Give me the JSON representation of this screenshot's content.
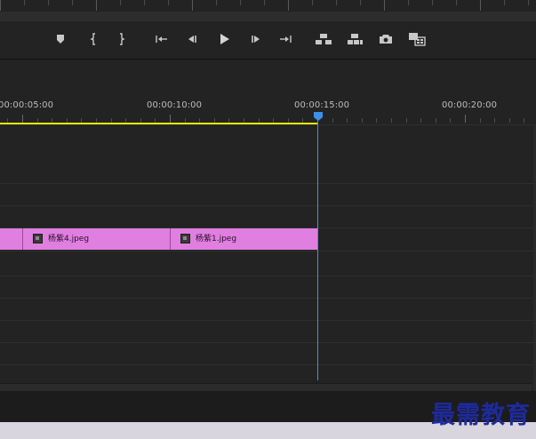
{
  "transport": {
    "controls": [
      {
        "name": "add-marker-button",
        "icon": "marker-icon"
      },
      {
        "name": "mark-in-button",
        "icon": "mark-in-icon"
      },
      {
        "name": "mark-out-button",
        "icon": "mark-out-icon"
      },
      {
        "name": "go-to-in-button",
        "icon": "go-to-in-icon"
      },
      {
        "name": "step-back-button",
        "icon": "step-back-icon"
      },
      {
        "name": "play-button",
        "icon": "play-icon"
      },
      {
        "name": "step-forward-button",
        "icon": "step-forward-icon"
      },
      {
        "name": "go-to-out-button",
        "icon": "go-to-out-icon"
      },
      {
        "name": "lift-button",
        "icon": "lift-icon"
      },
      {
        "name": "extract-button",
        "icon": "extract-icon"
      },
      {
        "name": "export-frame-button",
        "icon": "camera-icon"
      },
      {
        "name": "comparison-view-button",
        "icon": "compare-icon"
      }
    ]
  },
  "timeline": {
    "ruler_labels": [
      "00:00:05:00",
      "00:00:10:00",
      "00:00:15:00",
      "00:00:20:00"
    ],
    "clips": [
      {
        "name": ""
      },
      {
        "name": "杨紫4.jpeg"
      },
      {
        "name": "杨紫1.jpeg"
      }
    ],
    "colors": {
      "clip": "#e07fe0",
      "playhead": "#4a8fe0",
      "work_area": "#e6e600"
    }
  },
  "watermark": {
    "text": "最需教育"
  }
}
